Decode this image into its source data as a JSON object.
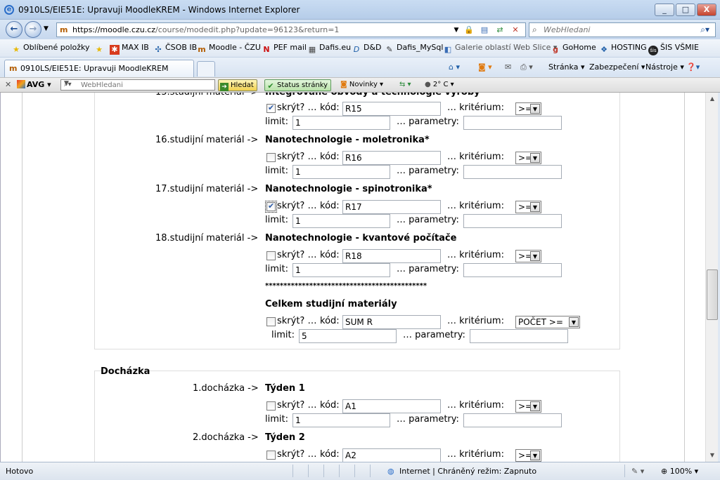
{
  "window": {
    "title": "0910LS/EIE51E: Upravuji MoodleKREM - Windows Internet Explorer",
    "minimize": "_",
    "maximize": "□",
    "close": "X"
  },
  "nav": {
    "back": "←",
    "forward": "→",
    "url_host": "https://moodle.czu.cz",
    "url_path": "/course/modedit.php?update=96123&return=1",
    "search_placeholder": "WebHledani"
  },
  "favorites": {
    "items": [
      "Oblíbené položky",
      "MAX IB",
      "ČSOB IB",
      "Moodle - ČZU",
      "PEF mail",
      "Dafis.eu",
      "D&D",
      "Dafis_MySql",
      "Galerie oblastí Web Slice ▾",
      "GoHome",
      "HOSTING",
      "ŠIS VŠMIE"
    ]
  },
  "tabs": {
    "active": "0910LS/EIE51E: Upravuji MoodleKREM",
    "commands": [
      "Stránka ▾",
      "Zabezpečení ▾",
      "Nástroje ▾"
    ]
  },
  "avg": {
    "brand": "AVG",
    "search_placeholder": "WebHledani",
    "hledat": "Hledat",
    "status": "Status stránky",
    "novinky": "Novinky ▾",
    "temp": "2° C ▾"
  },
  "labels": {
    "hide": "skrýt? …",
    "code": "kód:",
    "criterion": "… kritérium:",
    "limit": "limit:",
    "params": "… parametry:",
    "stars": "********************************************"
  },
  "materials": [
    {
      "label": "",
      "name": "",
      "hidden": true,
      "code": "R15",
      "criterion": ">=",
      "limit": "1"
    },
    {
      "label": "16.studijní materiál ->",
      "name": "Nanotechnologie - moletronika*",
      "hidden": false,
      "code": "R16",
      "criterion": ">=",
      "limit": "1"
    },
    {
      "label": "17.studijní materiál ->",
      "name": "Nanotechnologie - spinotronika*",
      "hidden": true,
      "code": "R17",
      "criterion": ">=",
      "limit": "1"
    },
    {
      "label": "18.studijní materiál ->",
      "name": "Nanotechnologie - kvantové počítače",
      "hidden": false,
      "code": "R18",
      "criterion": ">=",
      "limit": "1"
    }
  ],
  "total": {
    "name": "Celkem studijní materiály",
    "hidden": false,
    "code": "SUM R",
    "criterion": "POČET >=",
    "limit": "5"
  },
  "attendance": {
    "title": "Docházka",
    "items": [
      {
        "label": "1.docházka ->",
        "name": "Týden 1",
        "hidden": false,
        "code": "A1",
        "criterion": ">=",
        "limit": "1"
      },
      {
        "label": "2.docházka ->",
        "name": "Týden 2",
        "hidden": false,
        "code": "A2",
        "criterion": ">=",
        "limit": ""
      }
    ]
  },
  "status": {
    "text": "Hotovo",
    "zone": "Internet | Chráněný režim: Zapnuto",
    "zoom": "100%"
  },
  "colors": {
    "accent": "#2a6dc9",
    "checkmark": "#2b5aa7"
  }
}
